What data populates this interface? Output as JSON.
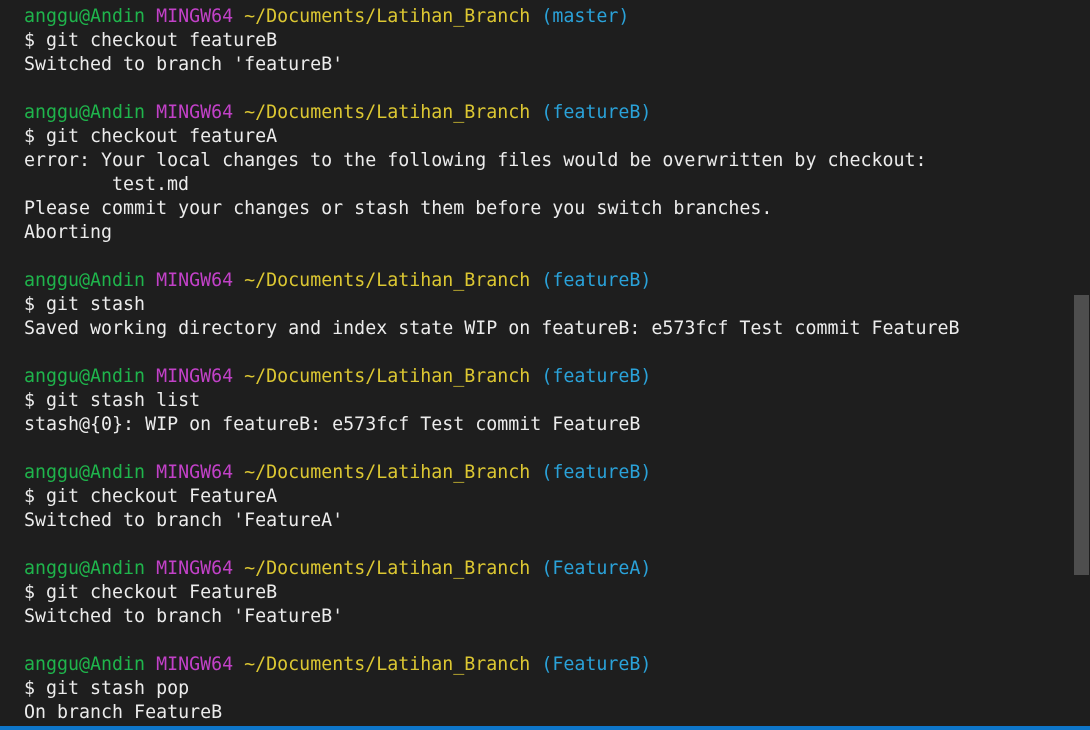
{
  "prompt": {
    "user_host": "anggu@Andin",
    "system": "MINGW64",
    "path": "~/Documents/Latihan_Branch"
  },
  "blocks": [
    {
      "branch": "(master)",
      "command": "$ git checkout featureB",
      "output": [
        "Switched to branch 'featureB'"
      ]
    },
    {
      "branch": "(featureB)",
      "command": "$ git checkout featureA",
      "output": [
        "error: Your local changes to the following files would be overwritten by checkout:",
        "test.md",
        "Please commit your changes or stash them before you switch branches.",
        "Aborting"
      ]
    },
    {
      "branch": "(featureB)",
      "command": "$ git stash",
      "output": [
        "Saved working directory and index state WIP on featureB: e573fcf Test commit FeatureB"
      ]
    },
    {
      "branch": "(featureB)",
      "command": "$ git stash list",
      "output": [
        "stash@{0}: WIP on featureB: e573fcf Test commit FeatureB"
      ]
    },
    {
      "branch": "(featureB)",
      "command": "$ git checkout FeatureA",
      "output": [
        "Switched to branch 'FeatureA'"
      ]
    },
    {
      "branch": "(FeatureA)",
      "command": "$ git checkout FeatureB",
      "output": [
        "Switched to branch 'FeatureB'"
      ]
    },
    {
      "branch": "(FeatureB)",
      "command": "$ git stash pop",
      "output": [
        "On branch FeatureB"
      ]
    }
  ]
}
